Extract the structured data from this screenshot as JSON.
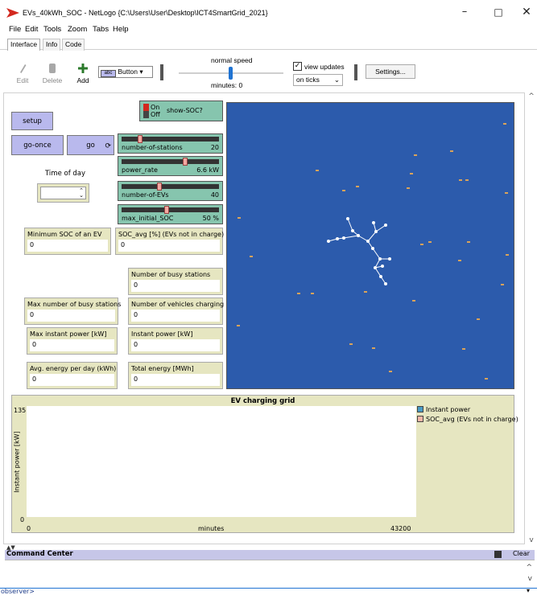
{
  "window": {
    "title": "EVs_40kWh_SOC - NetLogo {C:\\Users\\User\\Desktop\\ICT4SmartGrid_2021}",
    "minimize": "–",
    "maximize": "□",
    "close": "✕"
  },
  "menu": [
    "File",
    "Edit",
    "Tools",
    "Zoom",
    "Tabs",
    "Help"
  ],
  "tabs": [
    "Interface",
    "Info",
    "Code"
  ],
  "toolbar": {
    "edit_label": "Edit",
    "delete_label": "Delete",
    "add_label": "Add",
    "widget_type": "Button",
    "speed_label": "normal speed",
    "speed_fraction": 0.5,
    "ticks_label": "minutes: 0",
    "view_updates_label": "view updates",
    "view_updates_checked": true,
    "update_mode": "on ticks",
    "settings_label": "Settings..."
  },
  "widgets": {
    "setup": "setup",
    "go_once": "go-once",
    "go": "go",
    "show_soc_label": "show-SOC?",
    "switch_on": "On",
    "switch_off": "Off",
    "time_of_day_label": "Time of day",
    "sliders": [
      {
        "name": "number-of-stations",
        "value": "20",
        "fraction": 0.17
      },
      {
        "name": "power_rate",
        "value": "6.6 kW",
        "fraction": 0.66
      },
      {
        "name": "number-of-EVs",
        "value": "40",
        "fraction": 0.38
      },
      {
        "name": "max_initial_SOC",
        "value": "50 %",
        "fraction": 0.46
      }
    ],
    "monitors": {
      "min_soc": {
        "label": "Minimum SOC of an EV",
        "value": "0"
      },
      "soc_avg": {
        "label": "SOC_avg [%] (EVs not in charge)",
        "value": "0"
      },
      "busy_stations": {
        "label": "Number of busy stations",
        "value": "0"
      },
      "max_busy": {
        "label": "Max number of busy stations",
        "value": "0"
      },
      "vehicles_charging": {
        "label": "Number of vehicles charging",
        "value": "0"
      },
      "max_power": {
        "label": "Max instant power  [kW]",
        "value": "0"
      },
      "instant_power": {
        "label": "Instant power [kW]",
        "value": "0"
      },
      "avg_energy": {
        "label": "Avg. energy per day (kWh)",
        "value": "0"
      },
      "total_energy": {
        "label": "Total energy [MWh]",
        "value": "0"
      }
    }
  },
  "colors": {
    "world_bg": "#2c5bac",
    "button": "#b9b9ed",
    "slider": "#86c5ae",
    "monitor": "#e6e6c1",
    "series_instant_power": "#4a9cc5",
    "series_soc_avg": "#f5b8a8"
  },
  "plot": {
    "title": "EV charging grid",
    "ylabel": "Instant power [kW]",
    "xlabel": "minutes",
    "ymax": "135",
    "ymin": "0",
    "xmin": "0",
    "xmax": "43200",
    "legend": [
      "Instant power",
      "SOC_avg (EVs not in charge)"
    ]
  },
  "command_center": {
    "title": "Command Center",
    "clear_label": "Clear",
    "observer_prompt": "observer>"
  }
}
